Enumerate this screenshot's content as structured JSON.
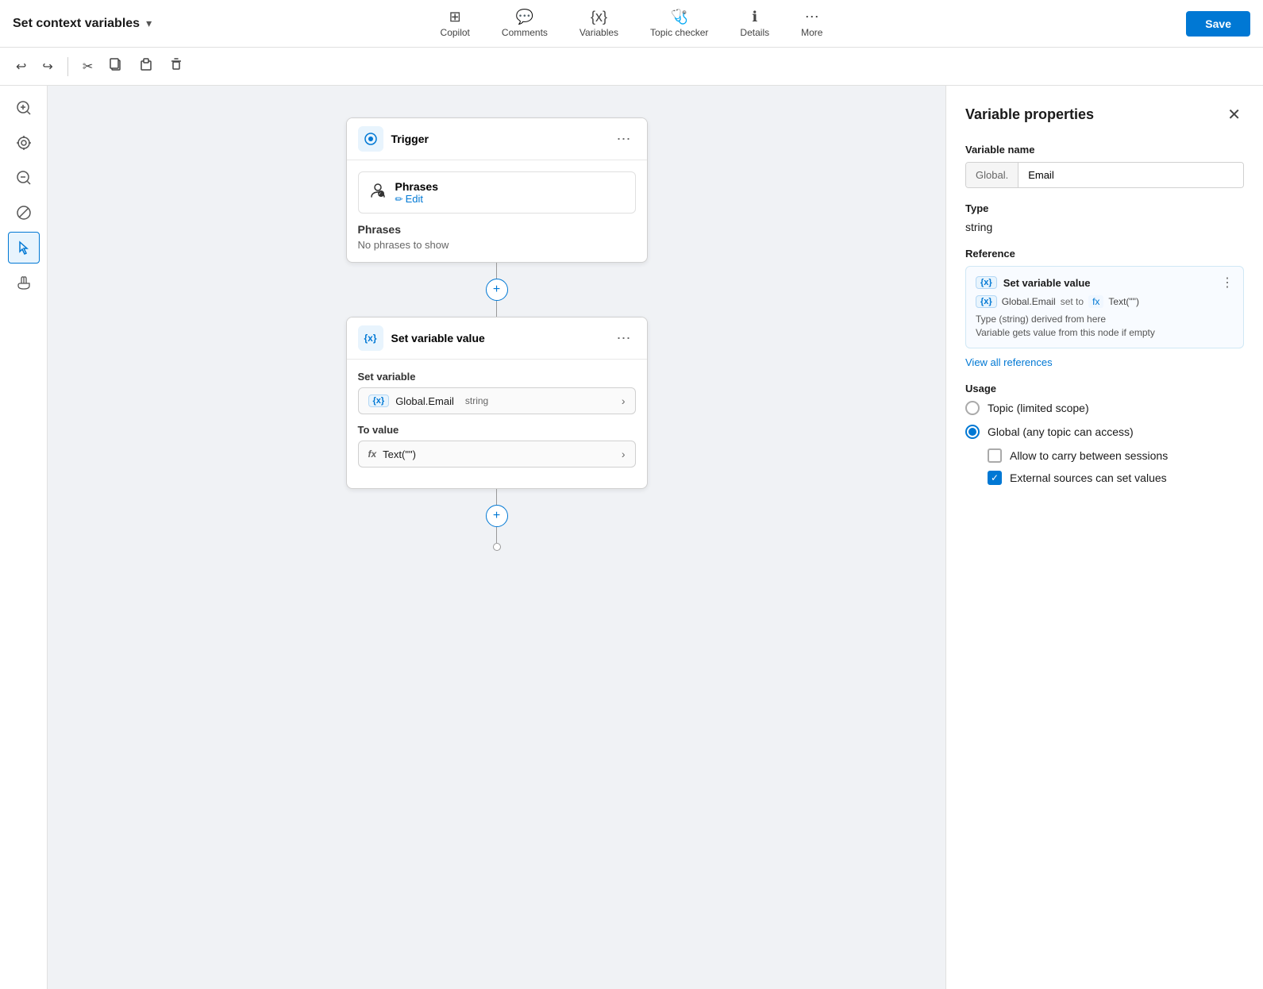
{
  "app": {
    "title": "Set context variables",
    "title_chevron": "▾"
  },
  "top_nav": {
    "copilot_label": "Copilot",
    "comments_label": "Comments",
    "variables_label": "Variables",
    "topic_checker_label": "Topic checker",
    "details_label": "Details",
    "more_label": "More",
    "save_label": "Save"
  },
  "toolbar": {
    "undo_icon": "↩",
    "redo_icon": "↪",
    "cut_icon": "✂",
    "copy_icon": "⧉",
    "paste_icon": "📋",
    "delete_icon": "🗑"
  },
  "canvas": {
    "trigger_node": {
      "title": "Trigger",
      "menu_icon": "⋯",
      "phrases_label": "Phrases",
      "edit_label": "Edit",
      "phrases_section_label": "Phrases",
      "phrases_empty": "No phrases to show"
    },
    "set_variable_node": {
      "title": "Set variable value",
      "menu_icon": "⋯",
      "set_variable_label": "Set variable",
      "var_badge": "{x}",
      "var_name": "Global.Email",
      "var_type": "string",
      "to_value_label": "To value",
      "fx_badge": "fx",
      "fx_value": "Text(\"\")"
    }
  },
  "right_panel": {
    "title": "Variable properties",
    "close_icon": "✕",
    "variable_name_label": "Variable name",
    "var_prefix": "Global.",
    "var_input_value": "Email",
    "type_label": "Type",
    "type_value": "string",
    "reference_label": "Reference",
    "ref_badge": "{x}",
    "ref_title": "Set variable value",
    "ref_set_badge": "{x}",
    "ref_var_name": "Global.Email",
    "ref_set_to": "set to",
    "ref_fx": "fx",
    "ref_fx_value": "Text(\"\")",
    "ref_menu_icon": "⋮",
    "ref_note_line1": "Type (string) derived from here",
    "ref_note_line2": "Variable gets value from this node if empty",
    "view_refs_label": "View all references",
    "usage_label": "Usage",
    "usage_topic_label": "Topic (limited scope)",
    "usage_global_label": "Global (any topic can access)",
    "carry_sessions_label": "Allow to carry between sessions",
    "external_sources_label": "External sources can set values"
  },
  "sidebar_tools": [
    {
      "name": "zoom-in",
      "icon": "⊕"
    },
    {
      "name": "center",
      "icon": "◎"
    },
    {
      "name": "zoom-out",
      "icon": "⊖"
    },
    {
      "name": "no-entry",
      "icon": "⊘"
    },
    {
      "name": "cursor",
      "icon": "⬆",
      "active": true
    },
    {
      "name": "hand",
      "icon": "✋"
    }
  ]
}
